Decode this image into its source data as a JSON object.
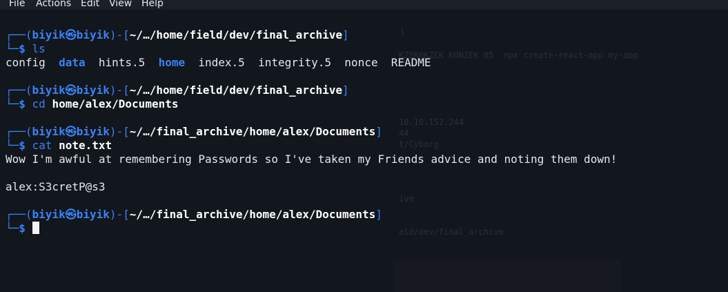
{
  "menu": {
    "items": [
      "File",
      "Actions",
      "Edit",
      "View",
      "Help"
    ]
  },
  "prompt": {
    "user": "biyik",
    "host": "biyik",
    "at_symbol": "㉿",
    "corner_top": "┌──(",
    "corner_bottom": "└─",
    "dollar": "$"
  },
  "blocks": [
    {
      "path": "~/…/home/field/dev/final_archive",
      "command": "ls",
      "argument": ""
    },
    {
      "path": "~/…/home/field/dev/final_archive",
      "command": "cd",
      "argument": "home/alex/Documents"
    },
    {
      "path": "~/…/final_archive/home/alex/Documents",
      "command": "cat",
      "argument": "note.txt"
    },
    {
      "path": "~/…/final_archive/home/alex/Documents",
      "command": "",
      "argument": ""
    }
  ],
  "ls_output": [
    {
      "name": "config",
      "type": "file"
    },
    {
      "name": "data",
      "type": "dir"
    },
    {
      "name": "hints.5",
      "type": "file"
    },
    {
      "name": "home",
      "type": "dir"
    },
    {
      "name": "index.5",
      "type": "file"
    },
    {
      "name": "integrity.5",
      "type": "file"
    },
    {
      "name": "nonce",
      "type": "file"
    },
    {
      "name": "README",
      "type": "file"
    }
  ],
  "note_output": {
    "line1": "Wow I'm awful at remembering Passwords so I've taken my Friends advice and noting them down!",
    "line2": "alex:S3cretP@s3"
  },
  "ghost_text": {
    "a": "l",
    "b": "KZEK@KZEK KONZEK 05  npx create-react-app my-app",
    "c": "10.10.152.244",
    "d": "44",
    "e": "t/Cyborg",
    "f": "ive",
    "g": "eld/dev/final_archive"
  },
  "colors": {
    "background": "#12161d",
    "accent_blue": "#3b82f6",
    "text": "#e6e8ec",
    "menubar": "#1b1f27"
  }
}
